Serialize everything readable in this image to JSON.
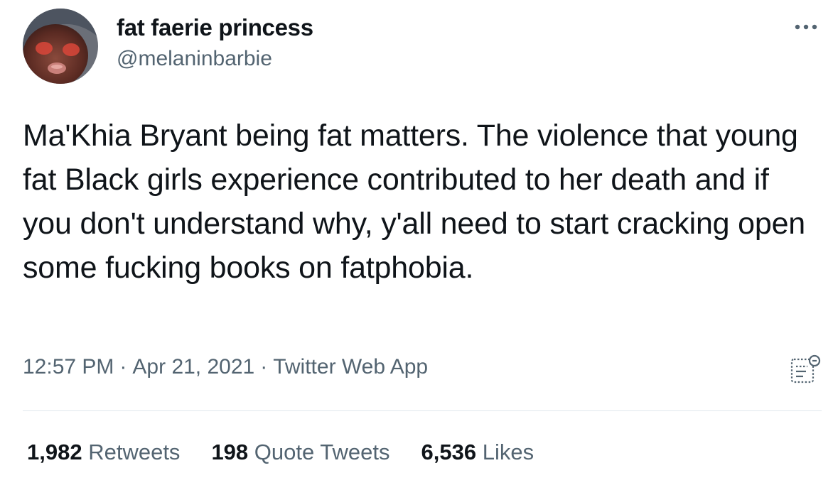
{
  "author": {
    "display_name": "fat faerie princess",
    "handle": "@melaninbarbie"
  },
  "tweet": {
    "text": "Ma'Khia Bryant being fat matters. The violence that young fat Black girls experience contributed to her death and if you don't understand why, y'all need to start cracking open some fucking books on fatphobia.",
    "time": "12:57 PM",
    "date": "Apr 21, 2021",
    "source": "Twitter Web App",
    "separator": "·"
  },
  "stats": {
    "retweets_count": "1,982",
    "retweets_label": "Retweets",
    "quotes_count": "198",
    "quotes_label": "Quote Tweets",
    "likes_count": "6,536",
    "likes_label": "Likes"
  },
  "icons": {
    "more": "more-horizontal-icon",
    "analytics": "analytics-icon"
  },
  "colors": {
    "text": "#0f1419",
    "secondary": "#536471",
    "divider": "#e1e8ed"
  }
}
